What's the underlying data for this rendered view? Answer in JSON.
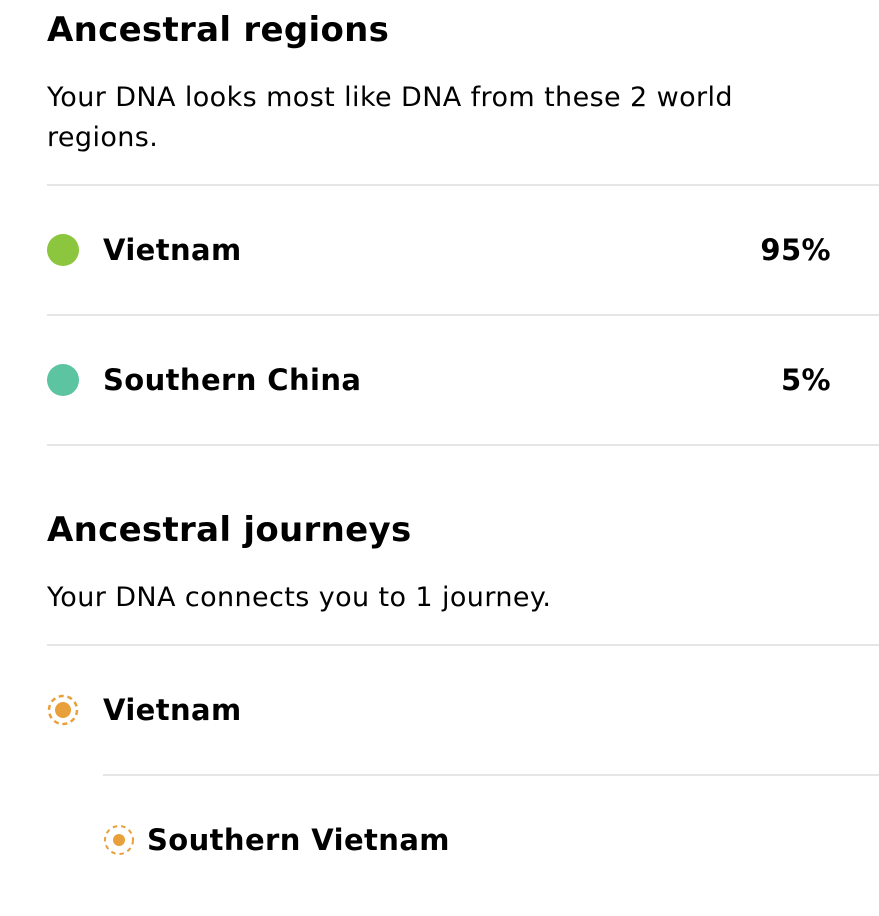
{
  "regions": {
    "title": "Ancestral regions",
    "description": "Your DNA looks most like DNA from these 2 world regions.",
    "items": [
      {
        "name": "Vietnam",
        "percent": "95%",
        "color": "#8cc63f"
      },
      {
        "name": "Southern China",
        "percent": "5%",
        "color": "#5cc4a0"
      }
    ]
  },
  "journeys": {
    "title": "Ancestral journeys",
    "description": "Your DNA connects you to 1 journey.",
    "items": [
      {
        "name": "Vietnam",
        "icon": "journey-sun-icon",
        "color": "#e9a03b"
      }
    ],
    "sub_items": [
      {
        "name": "Southern Vietnam",
        "icon": "journey-sun-icon",
        "color": "#e9a03b"
      }
    ]
  }
}
